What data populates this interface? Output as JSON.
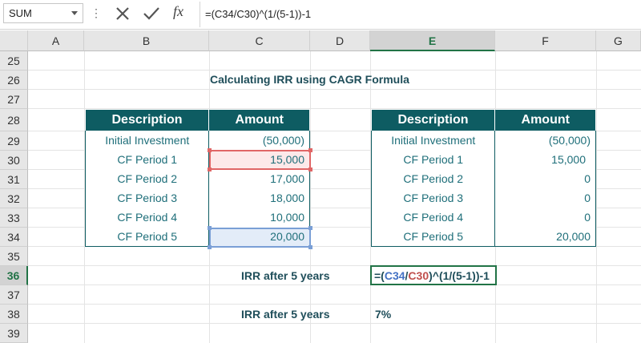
{
  "formula_bar": {
    "name_box": "SUM",
    "formula": "=(C34/C30)^(1/(5-1))-1",
    "fx_label": "fx",
    "dots": "⋮",
    "cancel_icon": "cancel-icon",
    "enter_icon": "enter-icon"
  },
  "columns": [
    "A",
    "B",
    "C",
    "D",
    "E",
    "F",
    "G"
  ],
  "selected_column": "E",
  "rows": [
    "25",
    "26",
    "27",
    "28",
    "29",
    "30",
    "31",
    "32",
    "33",
    "34",
    "35",
    "36",
    "37",
    "38",
    "39"
  ],
  "selected_row": "36",
  "title": "Calculating IRR using CAGR Formula",
  "table_left": {
    "headers": [
      "Description",
      "Amount"
    ],
    "rows": [
      [
        "Initial Investment",
        "(50,000)"
      ],
      [
        "CF Period 1",
        "15,000"
      ],
      [
        "CF Period 2",
        "17,000"
      ],
      [
        "CF Period 3",
        "18,000"
      ],
      [
        "CF Period 4",
        "10,000"
      ],
      [
        "CF Period 5",
        "20,000"
      ]
    ]
  },
  "table_right": {
    "headers": [
      "Description",
      "Amount"
    ],
    "rows": [
      [
        "Initial Investment",
        "(50,000)"
      ],
      [
        "CF Period 1",
        "15,000"
      ],
      [
        "CF Period 2",
        "0"
      ],
      [
        "CF Period 3",
        "0"
      ],
      [
        "CF Period 4",
        "0"
      ],
      [
        "CF Period 5",
        "20,000"
      ]
    ]
  },
  "irr_label_1": "IRR after 5 years",
  "irr_label_2": "IRR after 5 years",
  "edit_formula": {
    "p1": "=(",
    "ref1": "C34",
    "p2": "/",
    "ref2": "C30",
    "p3": ")^(1/(5-1))-1"
  },
  "irr_result": "7%",
  "colors": {
    "header_fill": "#0e5c62",
    "text_teal": "#1f6f7a",
    "ref_blue": "#4472c4",
    "ref_red": "#c0504d",
    "excel_green": "#217346"
  }
}
